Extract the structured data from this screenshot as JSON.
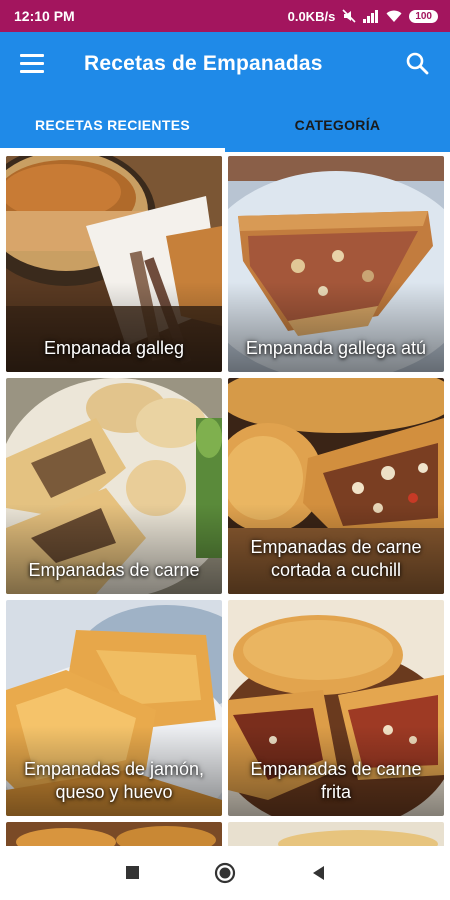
{
  "status_bar": {
    "time": "12:10 PM",
    "net_speed": "0.0KB/s",
    "battery": "100"
  },
  "app_bar": {
    "title": "Recetas de Empanadas",
    "menu_icon": "menu-icon",
    "search_icon": "search-icon"
  },
  "tabs": [
    {
      "label": "RECETAS RECIENTES"
    },
    {
      "label": "CATEGORÍA"
    }
  ],
  "recipes": [
    {
      "label": "Empanada galleg"
    },
    {
      "label": "Empanada gallega atú"
    },
    {
      "label": "Empanadas de carne"
    },
    {
      "label": "Empanadas de carne cortada a cuchill"
    },
    {
      "label": "Empanadas de jamón, queso y huevo"
    },
    {
      "label": "Empanadas de carne frita"
    }
  ],
  "colors": {
    "status_bar": "#a3155e",
    "app_bar": "#1f8ae8",
    "indicator": "#ffffff"
  },
  "nav_bar": {
    "recents_icon": "square-icon",
    "home_icon": "circle-icon",
    "back_icon": "triangle-back-icon"
  }
}
